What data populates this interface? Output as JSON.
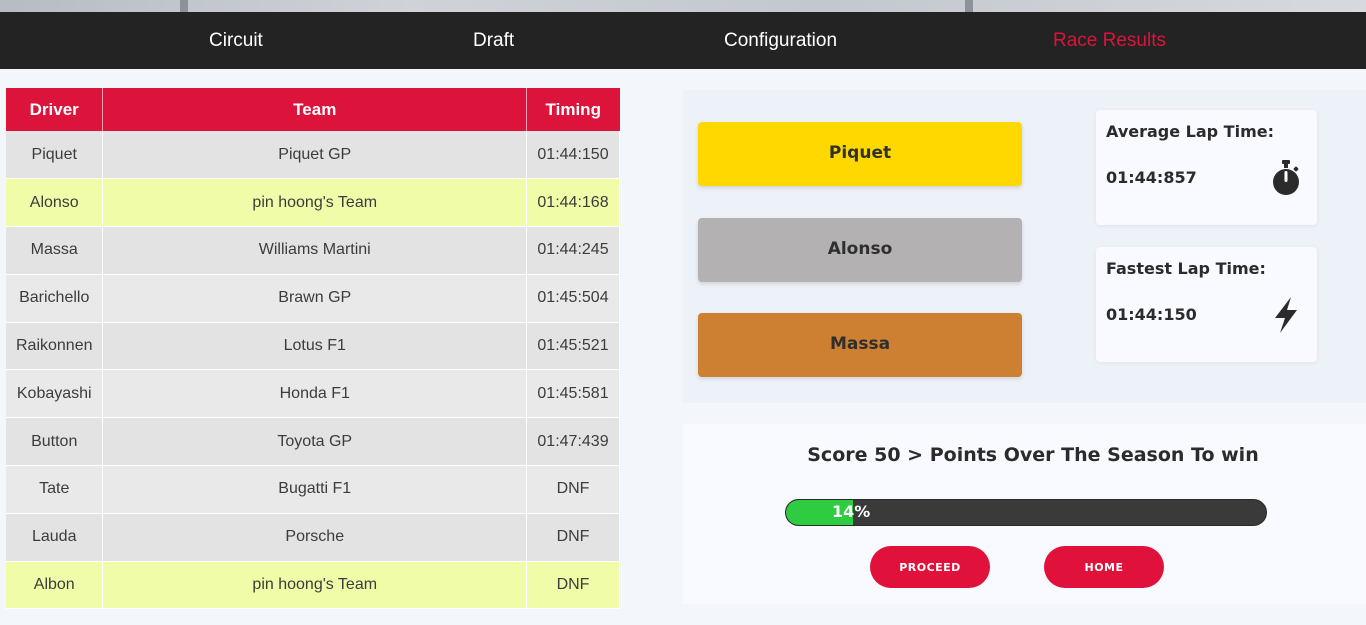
{
  "nav": {
    "items": [
      {
        "label": "Circuit"
      },
      {
        "label": "Draft"
      },
      {
        "label": "Configuration"
      },
      {
        "label": "Race Results"
      }
    ],
    "active_index": 3
  },
  "results": {
    "headers": [
      "Driver",
      "Team",
      "Timing"
    ],
    "rows": [
      {
        "driver": "Piquet",
        "team": "Piquet GP",
        "timing": "01:44:150",
        "highlight": false
      },
      {
        "driver": "Alonso",
        "team": "pin hoong's Team",
        "timing": "01:44:168",
        "highlight": true
      },
      {
        "driver": "Massa",
        "team": "Williams Martini",
        "timing": "01:44:245",
        "highlight": false
      },
      {
        "driver": "Barichello",
        "team": "Brawn GP",
        "timing": "01:45:504",
        "highlight": false
      },
      {
        "driver": "Raikonnen",
        "team": "Lotus F1",
        "timing": "01:45:521",
        "highlight": false
      },
      {
        "driver": "Kobayashi",
        "team": "Honda F1",
        "timing": "01:45:581",
        "highlight": false
      },
      {
        "driver": "Button",
        "team": "Toyota GP",
        "timing": "01:47:439",
        "highlight": false
      },
      {
        "driver": "Tate",
        "team": "Bugatti F1",
        "timing": "DNF",
        "highlight": false
      },
      {
        "driver": "Lauda",
        "team": "Porsche",
        "timing": "DNF",
        "highlight": false
      },
      {
        "driver": "Albon",
        "team": "pin hoong's Team",
        "timing": "DNF",
        "highlight": true
      }
    ]
  },
  "podium": {
    "first": "Piquet",
    "second": "Alonso",
    "third": "Massa"
  },
  "stats": {
    "average_title": "Average Lap Time:",
    "average_value": "01:44:857",
    "average_icon": "stopwatch-icon",
    "fastest_title": "Fastest Lap Time:",
    "fastest_value": "01:44:150",
    "fastest_icon": "lightning-bolt-icon"
  },
  "score": {
    "title": "Score 50 > Points Over The Season To win",
    "progress_percent": 14,
    "progress_label": "14%"
  },
  "buttons": {
    "proceed": "PROCEED",
    "home": "HOME"
  },
  "colors": {
    "accent": "#dc143c",
    "gold": "#ffd800",
    "silver": "#b3b1b1",
    "bronze": "#cd7f32",
    "progress": "#2ecc40",
    "highlight_row": "#f0fca8"
  }
}
